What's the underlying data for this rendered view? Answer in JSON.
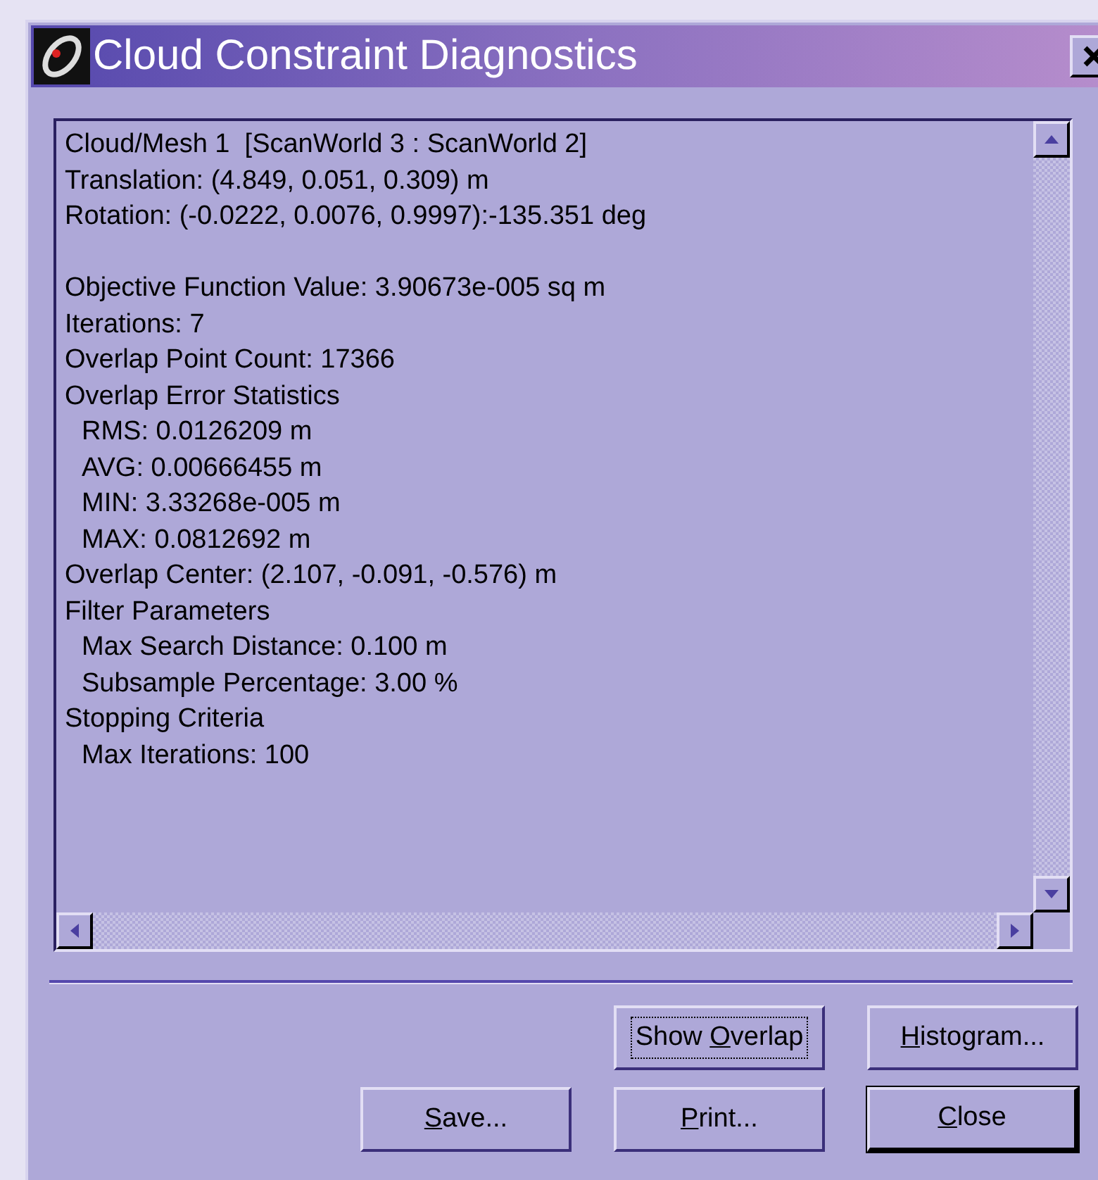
{
  "window": {
    "title": "Cloud Constraint Diagnostics"
  },
  "report": {
    "blocks": [
      [
        {
          "text": "Cloud/Mesh 1  [ScanWorld 3 : ScanWorld 2]"
        },
        {
          "text": "Translation: (4.849, 0.051, 0.309) m"
        },
        {
          "text": "Rotation: (-0.0222, 0.0076, 0.9997):-135.351 deg"
        }
      ],
      [
        {
          "text": "Objective Function Value: 3.90673e-005 sq m"
        },
        {
          "text": "Iterations: 7"
        },
        {
          "text": "Overlap Point Count: 17366"
        },
        {
          "text": "Overlap Error Statistics",
          "children": [
            {
              "text": "RMS: 0.0126209 m"
            },
            {
              "text": "AVG: 0.00666455 m"
            },
            {
              "text": "MIN: 3.33268e-005 m"
            },
            {
              "text": "MAX: 0.0812692 m"
            }
          ]
        },
        {
          "text": "Overlap Center: (2.107, -0.091, -0.576) m"
        },
        {
          "text": "Filter Parameters",
          "children": [
            {
              "text": "Max Search Distance: 0.100 m"
            },
            {
              "text": "Subsample Percentage: 3.00 %"
            }
          ]
        },
        {
          "text": "Stopping Criteria",
          "children": [
            {
              "text": "Max Iterations: 100"
            }
          ]
        }
      ]
    ]
  },
  "button_rows": [
    [
      {
        "before": "Show ",
        "access_key": "O",
        "after": "verlap",
        "focused": true,
        "default": false
      },
      {
        "access_key": "H",
        "after": "istogram...",
        "focused": false,
        "default": false
      }
    ],
    [
      {
        "access_key": "S",
        "after": "ave...",
        "focused": false,
        "default": false
      },
      {
        "access_key": "P",
        "after": "rint...",
        "focused": false,
        "default": false
      },
      {
        "access_key": "C",
        "after": "lose",
        "focused": false,
        "default": true
      }
    ]
  ]
}
